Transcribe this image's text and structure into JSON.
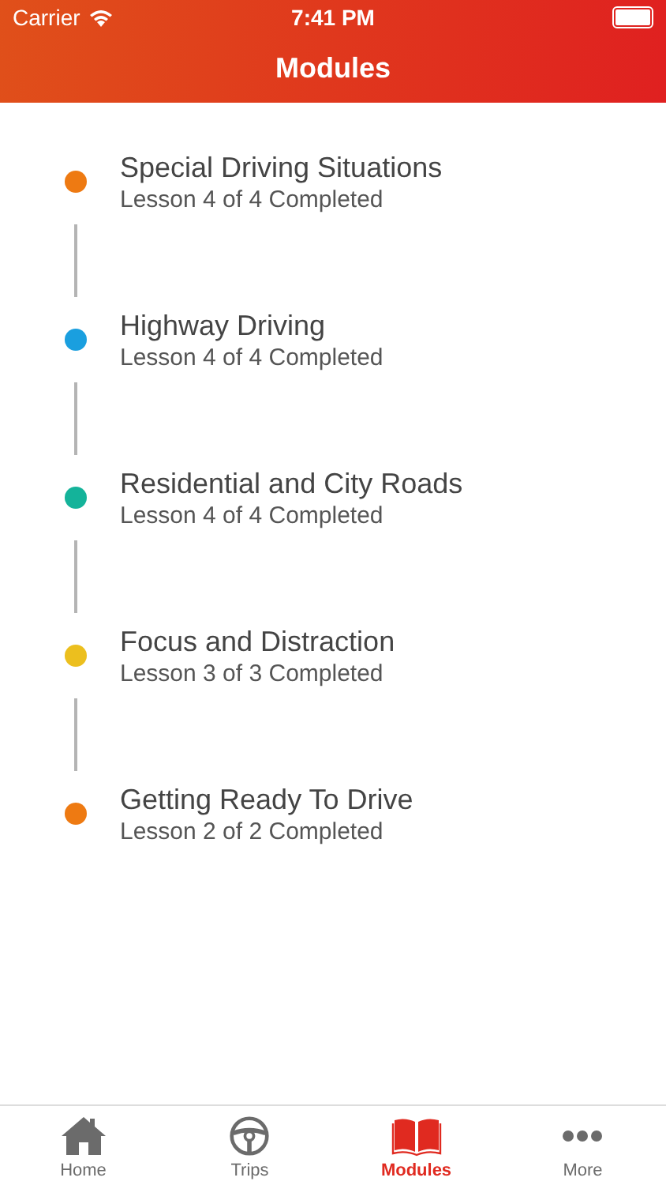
{
  "status_bar": {
    "carrier": "Carrier",
    "time": "7:41 PM"
  },
  "nav": {
    "title": "Modules"
  },
  "modules": [
    {
      "title": "Special Driving Situations",
      "progress": "Lesson 4 of 4 Completed",
      "color": "#ee7a12"
    },
    {
      "title": "Highway Driving",
      "progress": "Lesson 4 of 4 Completed",
      "color": "#1a9fdf"
    },
    {
      "title": "Residential and City Roads",
      "progress": "Lesson 4 of 4 Completed",
      "color": "#14b39a"
    },
    {
      "title": "Focus and Distraction",
      "progress": "Lesson 3 of 3 Completed",
      "color": "#ecbf1e"
    },
    {
      "title": "Getting Ready To Drive",
      "progress": "Lesson 2 of 2 Completed",
      "color": "#ee7a12"
    }
  ],
  "tab_bar": [
    {
      "label": "Home",
      "kind": "home",
      "selected": false
    },
    {
      "label": "Trips",
      "kind": "wheel",
      "selected": false
    },
    {
      "label": "Modules",
      "kind": "book",
      "selected": true
    },
    {
      "label": "More",
      "kind": "more",
      "selected": false
    }
  ]
}
